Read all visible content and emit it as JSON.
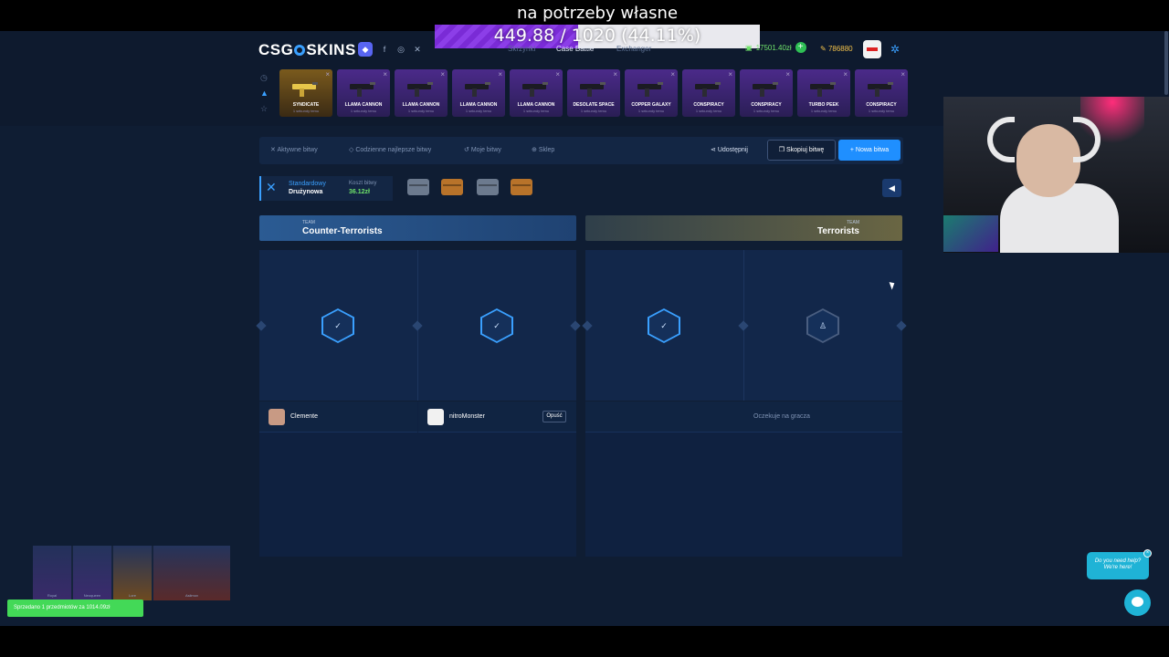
{
  "overlay": {
    "title": "na potrzeby własne",
    "goal_text": "449.88 / 1020 (44.11%)",
    "goal_fraction": 0.4411
  },
  "header": {
    "logo_left": "CSG",
    "logo_right": "SKINS",
    "nav": [
      "Skrzynki",
      "Case Battle",
      "Exchanger"
    ],
    "balance": "17501.40zł",
    "coins": "786880"
  },
  "drops": [
    {
      "name": "SYNDICATE",
      "sub": "1 sekundy temu",
      "style": "gold"
    },
    {
      "name": "LLAMA CANNON",
      "sub": "1 sekundy temu",
      "style": "purple"
    },
    {
      "name": "LLAMA CANNON",
      "sub": "1 sekundy temu",
      "style": "purple"
    },
    {
      "name": "LLAMA CANNON",
      "sub": "1 sekundy temu",
      "style": "purple"
    },
    {
      "name": "LLAMA CANNON",
      "sub": "1 sekundy temu",
      "style": "purple"
    },
    {
      "name": "DESOLATE SPACE",
      "sub": "1 sekundy temu",
      "style": "purple"
    },
    {
      "name": "COPPER GALAXY",
      "sub": "1 sekundy temu",
      "style": "purple"
    },
    {
      "name": "CONSPIRACY",
      "sub": "1 sekundy temu",
      "style": "purple"
    },
    {
      "name": "CONSPIRACY",
      "sub": "1 sekundy temu",
      "style": "purple"
    },
    {
      "name": "TURBO PEEK",
      "sub": "1 sekundy temu",
      "style": "purple"
    },
    {
      "name": "CONSPIRACY",
      "sub": "1 sekundy temu",
      "style": "purple"
    }
  ],
  "toolbar": {
    "items": [
      "Aktywne bitwy",
      "Codzienne najlepsze bitwy",
      "Moje bitwy",
      "Sklep"
    ],
    "share": "Udostępnij",
    "copy": "Skopiuj bitwę",
    "new": "+ Nowa bitwa"
  },
  "mode": {
    "type_label": "Standardowy",
    "type_value": "Drużynowa",
    "cost_label": "Koszt bitwy",
    "cost_value": "36.12zł"
  },
  "teams": {
    "ct_label": "TEAM",
    "ct_name": "Counter-Terrorists",
    "t_label": "TEAM",
    "t_name": "Terrorists"
  },
  "players": [
    {
      "name": "Clemente",
      "leave": ""
    },
    {
      "name": "nitroMonster",
      "leave": "Opuść"
    }
  ],
  "waiting_text": "Oczekuje na gracza",
  "live_drops": [
    "Royal",
    "Neoqueen",
    "Lore",
    "Asiimov"
  ],
  "toast": "Sprzedano 1 przedmiotów za 1014.09zł",
  "help": {
    "line1": "Do you need help?",
    "line2": "We're here!"
  },
  "colors": {
    "accent": "#1f8fff",
    "background": "#0f1d33",
    "success": "#43d957"
  }
}
